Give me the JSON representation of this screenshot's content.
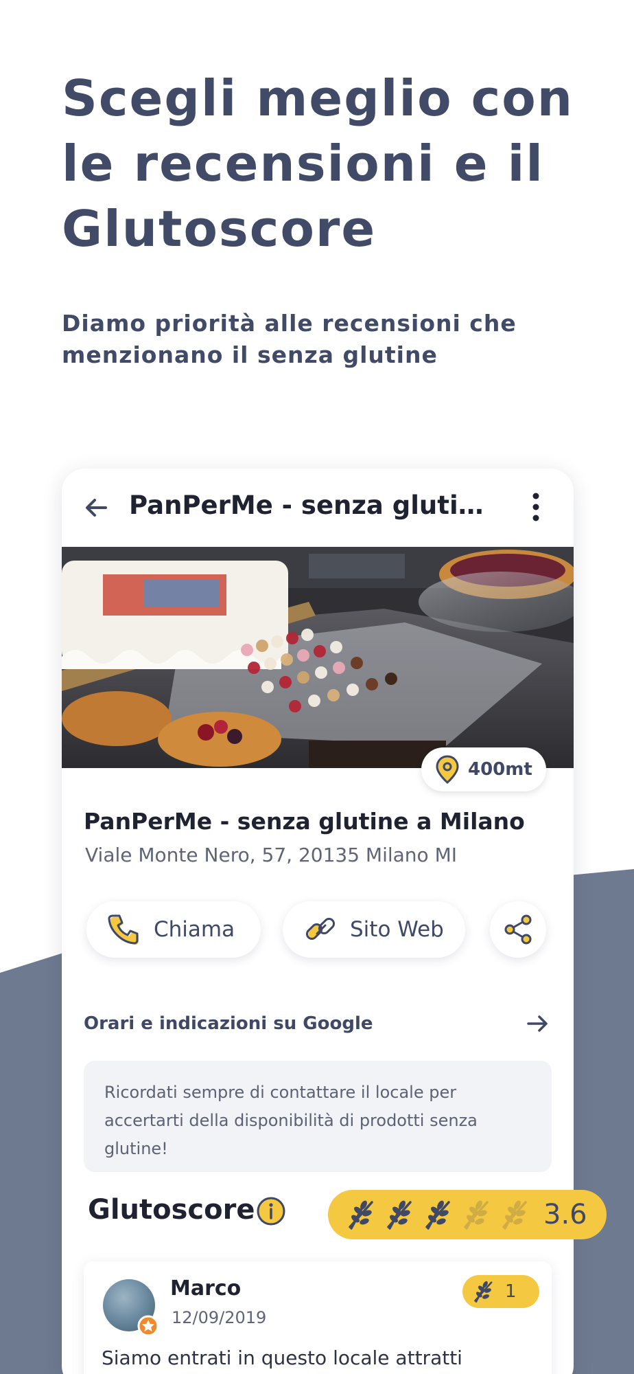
{
  "colors": {
    "accent_yellow": "#f5c842",
    "slate": "#6e7a90",
    "heading": "#414b68"
  },
  "headline": "Scegli meglio con le recensioni e il Glutoscore",
  "subhead": "Diamo priorità alle recensioni che menzionano il senza glutine",
  "card": {
    "title": "PanPerMe - senza glutin...",
    "icons": {
      "back": "arrow-left-icon",
      "more": "more-vertical-icon"
    },
    "distance": "400mt",
    "place_name": "PanPerMe - senza glutine a Milano",
    "address": "Viale Monte Nero, 57, 20135 Milano MI",
    "actions": {
      "call": "Chiama",
      "website": "Sito Web"
    },
    "hours_link": "Orari e indicazioni su Google",
    "notice": "Ricordati sempre di contattare il locale per accertarti della disponibilità di prodotti senza glutine!",
    "glutoscore": {
      "label": "Glutoscore",
      "value": "3.6",
      "rating": 3.6,
      "max": 5
    },
    "review": {
      "name": "Marco",
      "date": "12/09/2019",
      "score": "1",
      "text": "Siamo entrati in questo locale attratti"
    }
  }
}
